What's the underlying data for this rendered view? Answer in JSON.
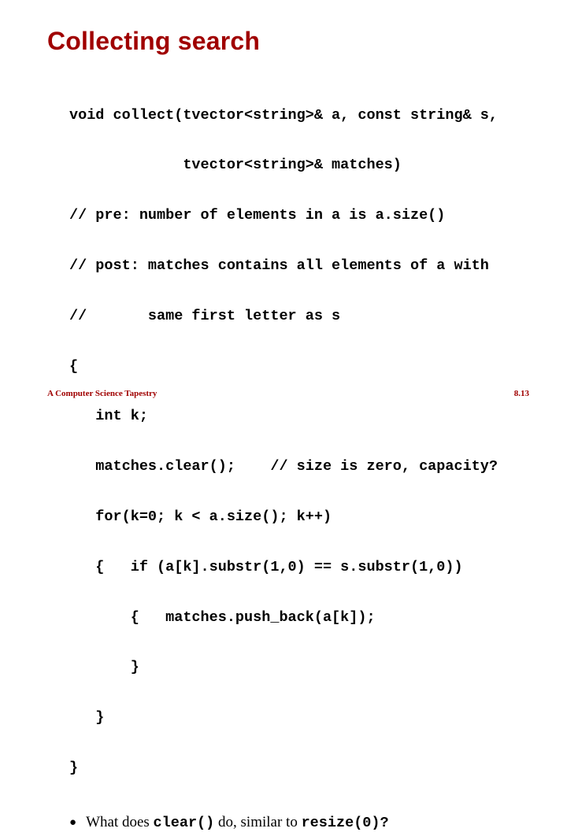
{
  "title": "Collecting search",
  "code_lines": [
    "void collect(tvector<string>& a, const string& s,",
    "             tvector<string>& matches)",
    "// pre: number of elements in a is a.size()",
    "// post: matches contains all elements of a with",
    "//       same first letter as s",
    "{",
    "   int k;",
    "   matches.clear();    // size is zero, capacity?",
    "   for(k=0; k < a.size(); k++)",
    "   {   if (a[k].substr(1,0) == s.substr(1,0))",
    "       {   matches.push_back(a[k]);",
    "       }",
    "   }",
    "}"
  ],
  "bullet": {
    "prefix": "What does ",
    "code1": "clear()",
    "mid": " do, similar to ",
    "code2": "resize(0)?"
  },
  "footer": {
    "left": "A Computer Science Tapestry",
    "right": "8.13"
  }
}
